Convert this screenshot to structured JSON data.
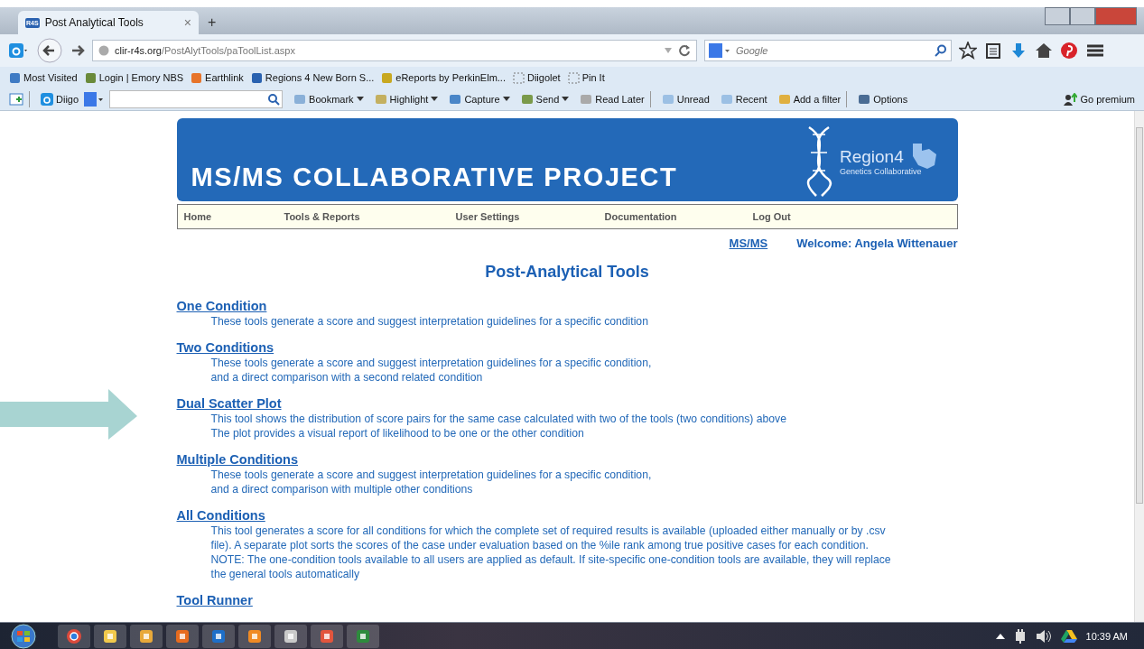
{
  "browser": {
    "tab": {
      "icon_text": "R4S",
      "title": "Post Analytical Tools",
      "close": "×",
      "new_tab": "+"
    },
    "url": {
      "host": "clir-r4s.org",
      "path": "/PostAlytTools/paToolList.aspx"
    },
    "search": {
      "placeholder": "Google"
    },
    "bookmarks": [
      {
        "label": "Most Visited"
      },
      {
        "label": "Login | Emory NBS"
      },
      {
        "label": "Earthlink"
      },
      {
        "label": "Regions 4 New Born S..."
      },
      {
        "label": "eReports by PerkinElm..."
      },
      {
        "label": "Diigolet"
      },
      {
        "label": "Pin It"
      }
    ],
    "diigo": {
      "brand": "Diigo",
      "items": [
        {
          "label": "Bookmark",
          "menu": true
        },
        {
          "label": "Highlight",
          "menu": true
        },
        {
          "label": "Capture",
          "menu": true
        },
        {
          "label": "Send",
          "menu": true
        },
        {
          "label": "Read Later",
          "menu": false
        },
        {
          "label": "Unread",
          "menu": false
        },
        {
          "label": "Recent",
          "menu": false
        },
        {
          "label": "Add a filter",
          "menu": false
        },
        {
          "label": "Options",
          "menu": false
        }
      ],
      "premium": "Go premium"
    }
  },
  "page": {
    "banner": {
      "title": "MS/MS COLLABORATIVE PROJECT",
      "logo_name": "Region4",
      "logo_sub": "Genetics Collaborative"
    },
    "nav": [
      {
        "label": "Home"
      },
      {
        "label": "Tools & Reports"
      },
      {
        "label": "User Settings"
      },
      {
        "label": "Documentation"
      },
      {
        "label": "Log Out"
      }
    ],
    "context_link": "MS/MS",
    "welcome": "Welcome: Angela Wittenauer",
    "heading": "Post-Analytical Tools",
    "sections": [
      {
        "title": "One Condition",
        "lines": [
          "These tools generate a score and suggest interpretation guidelines for a specific condition"
        ]
      },
      {
        "title": "Two Conditions",
        "lines": [
          "These tools generate a score and suggest interpretation guidelines for a specific condition,",
          "and a direct comparison with a second related condition"
        ]
      },
      {
        "title": "Dual Scatter Plot",
        "lines": [
          "This tool shows the distribution of score pairs for the same case calculated with two of the tools (two conditions) above",
          "The plot provides a visual report of likelihood to be one or the other condition"
        ]
      },
      {
        "title": "Multiple Conditions",
        "lines": [
          "These tools generate a score and suggest interpretation guidelines for a specific condition,",
          "and a direct comparison with multiple other conditions"
        ]
      },
      {
        "title": "All Conditions",
        "lines": [
          "This tool generates a score for all conditions for which the complete set of required results is available (uploaded either manually or by .csv",
          "file). A separate plot sorts the scores of the case under evaluation based on the %ile rank among true positive cases for each condition.",
          "NOTE: The one-condition tools available to all users are applied as default. If site-specific one-condition tools are available, they will replace",
          "the general tools automatically"
        ]
      },
      {
        "title": "Tool Runner"
      }
    ]
  },
  "taskbar": {
    "clock": "10:39 AM"
  }
}
